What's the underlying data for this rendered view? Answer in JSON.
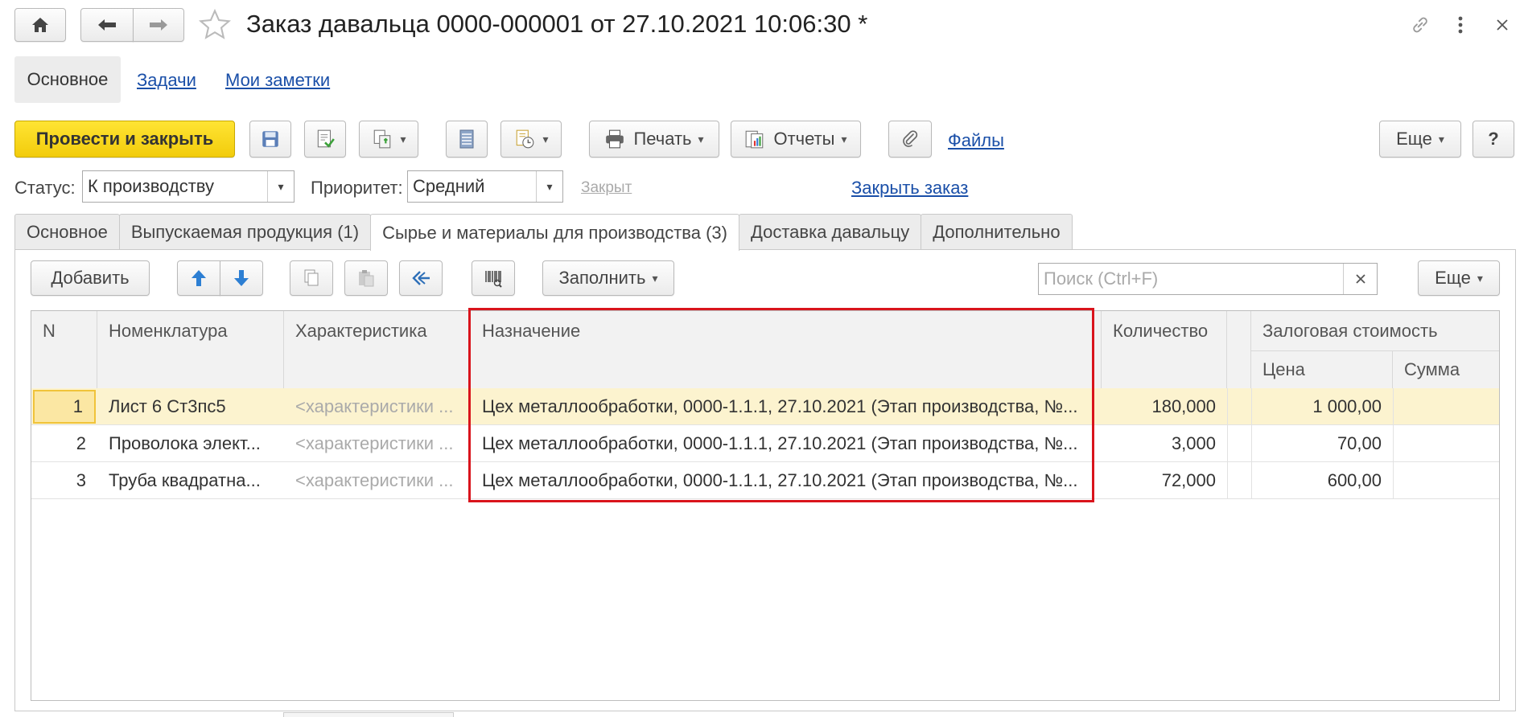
{
  "window": {
    "title": "Заказ давальца 0000-000001 от 27.10.2021 10:06:30 *",
    "icons": [
      "home-icon",
      "arrow-left-icon",
      "arrow-right-icon",
      "star-icon",
      "link-icon",
      "more-vertical-icon",
      "close-icon"
    ]
  },
  "top_nav": {
    "items": [
      {
        "label": "Основное",
        "active": true
      },
      {
        "label": "Задачи"
      },
      {
        "label": "Мои заметки"
      }
    ]
  },
  "toolbar": {
    "post_close_label": "Провести и закрыть",
    "print_label": "Печать",
    "reports_label": "Отчеты",
    "files_label": "Файлы",
    "more_label": "Еще",
    "help_label": "?",
    "accent_color": "#f5d418"
  },
  "fields": {
    "status_label": "Статус:",
    "status_value": "К производству",
    "priority_label": "Приоритет:",
    "priority_value": "Средний",
    "closed_label": "Закрыт",
    "close_order_label": "Закрыть заказ"
  },
  "tabs": [
    {
      "label": "Основное"
    },
    {
      "label": "Выпускаемая продукция (1)"
    },
    {
      "label": "Сырье и материалы для производства (3)",
      "active": true
    },
    {
      "label": "Доставка давальцу"
    },
    {
      "label": "Дополнительно"
    }
  ],
  "table_toolbar": {
    "add_label": "Добавить",
    "fill_label": "Заполнить",
    "search_placeholder": "Поиск (Ctrl+F)",
    "more_label": "Еще"
  },
  "table": {
    "headers": {
      "n": "N",
      "item": "Номенклатура",
      "characteristic": "Характеристика",
      "purpose": "Назначение",
      "quantity": "Количество",
      "deposit": "Залоговая стоимость",
      "price": "Цена",
      "sum": "Сумма"
    },
    "rows": [
      {
        "n": "1",
        "item": "Лист 6 Ст3пс5",
        "characteristic": "<характеристики ...",
        "purpose": "Цех металлообработки, 0000-1.1.1, 27.10.2021 (Этап производства, №...",
        "quantity": "180,000",
        "price": "1 000,00",
        "sum": ""
      },
      {
        "n": "2",
        "item": "Проволока элект...",
        "characteristic": "<характеристики ...",
        "purpose": "Цех металлообработки, 0000-1.1.1, 27.10.2021 (Этап производства, №...",
        "quantity": "3,000",
        "price": "70,00",
        "sum": ""
      },
      {
        "n": "3",
        "item": "Труба квадратна...",
        "characteristic": "<характеристики ...",
        "purpose": "Цех металлообработки, 0000-1.1.1, 27.10.2021 (Этап производства, №...",
        "quantity": "72,000",
        "price": "600,00",
        "sum": ""
      }
    ],
    "highlight_color": "#d9141c",
    "selected_row_color": "#fcf3cf"
  }
}
